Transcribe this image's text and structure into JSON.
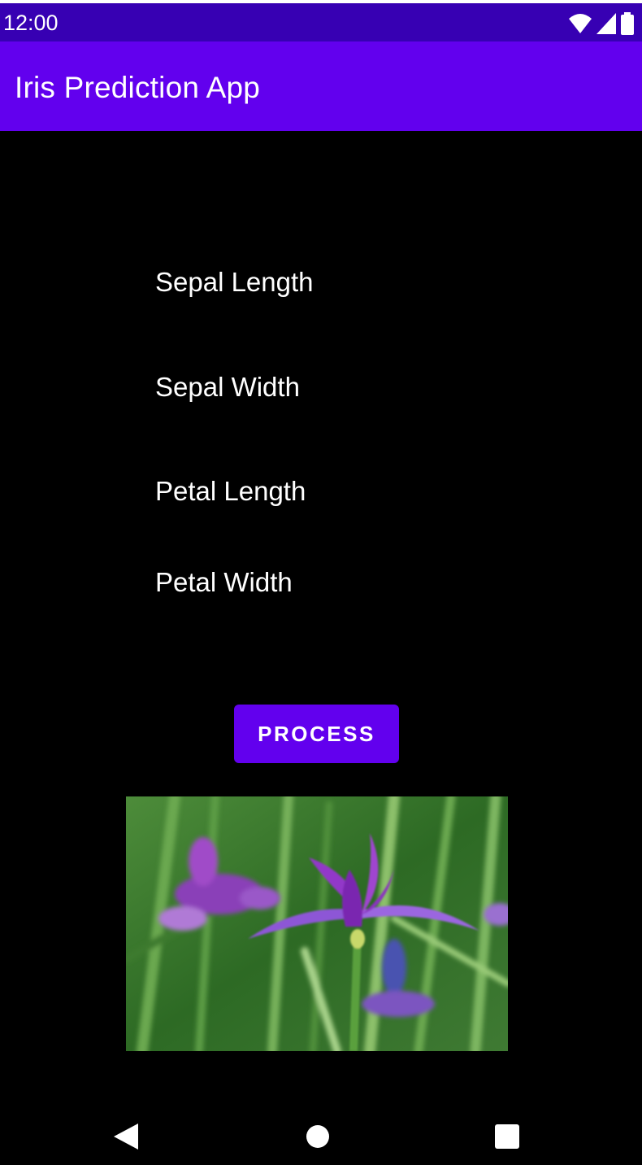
{
  "status_bar": {
    "time": "12:00",
    "icons": [
      "wifi-icon",
      "cell-signal-icon",
      "battery-icon"
    ],
    "color": "#3700B3"
  },
  "app_bar": {
    "title": "Iris Prediction App",
    "color": "#6200EE"
  },
  "form": {
    "fields": [
      {
        "label": "Sepal Length"
      },
      {
        "label": "Sepal Width"
      },
      {
        "label": "Petal Length"
      },
      {
        "label": "Petal Width"
      }
    ]
  },
  "actions": {
    "process_label": "PROCESS",
    "button_color": "#6200EE"
  },
  "image": {
    "subject": "iris-flower"
  },
  "nav_bar": {
    "buttons": [
      "back-icon",
      "home-icon",
      "recents-icon"
    ]
  }
}
